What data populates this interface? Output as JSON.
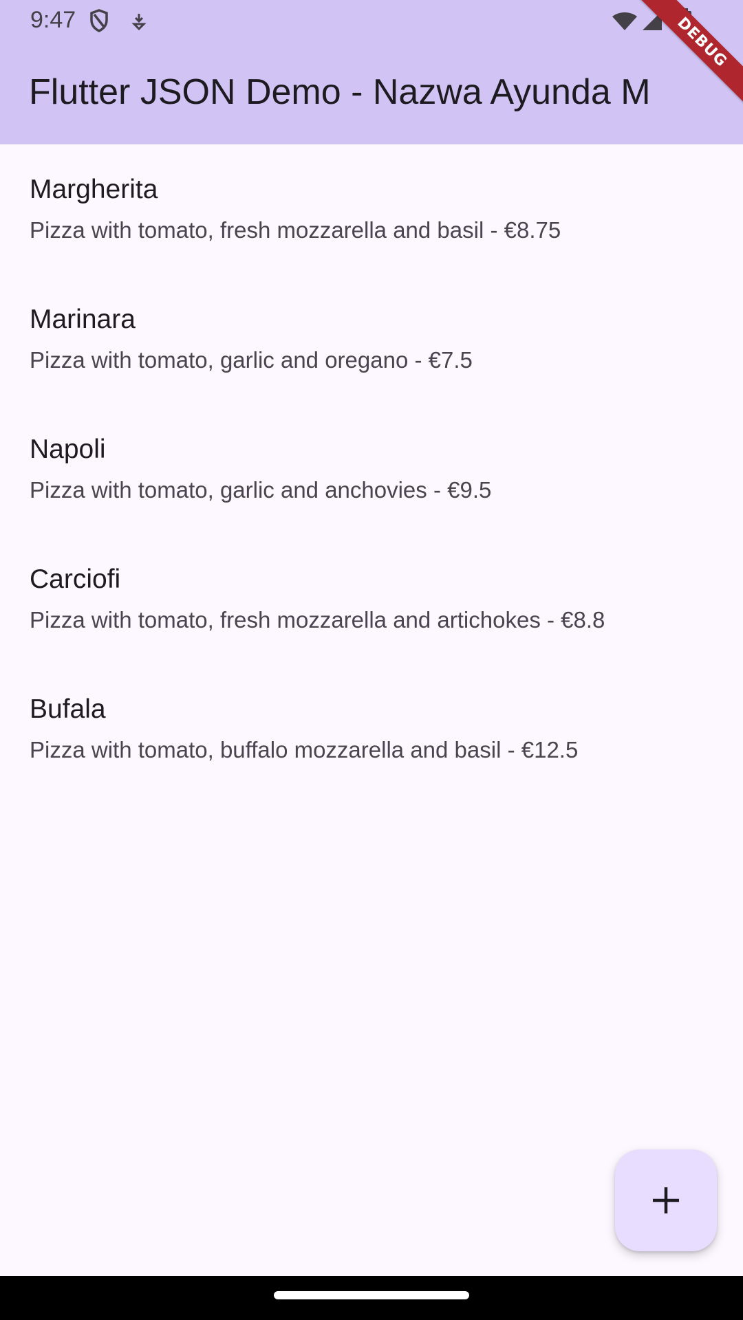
{
  "status_bar": {
    "time": "9:47",
    "icons": [
      "shield-icon",
      "download-icon",
      "wifi-icon",
      "signal-icon",
      "battery-icon"
    ]
  },
  "debug_banner": "DEBUG",
  "app_bar": {
    "title": "Flutter JSON Demo - Nazwa Ayunda M"
  },
  "pizzas": [
    {
      "name": "Margherita",
      "description": "Pizza with tomato, fresh mozzarella and basil - €8.75"
    },
    {
      "name": "Marinara",
      "description": "Pizza with tomato, garlic and oregano - €7.5"
    },
    {
      "name": "Napoli",
      "description": "Pizza with tomato, garlic and anchovies - €9.5"
    },
    {
      "name": "Carciofi",
      "description": "Pizza with tomato, fresh mozzarella and artichokes - €8.8"
    },
    {
      "name": "Bufala",
      "description": "Pizza with tomato, buffalo mozzarella and basil - €12.5"
    }
  ],
  "fab": {
    "icon": "plus-icon"
  },
  "colors": {
    "app_bar": "#d1c4f5",
    "background": "#fdf7ff",
    "fab": "#e9ddff",
    "debug_banner": "#b0262f"
  }
}
